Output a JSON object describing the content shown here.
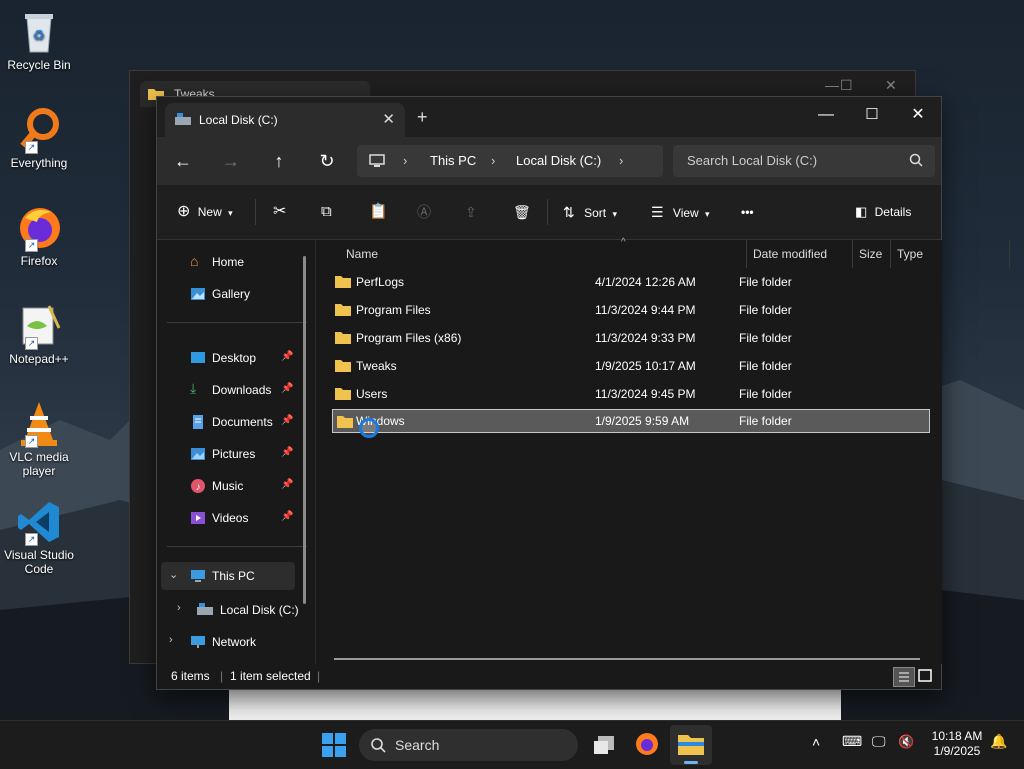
{
  "desktop": {
    "icons": [
      {
        "label": "Recycle Bin"
      },
      {
        "label": "Everything"
      },
      {
        "label": "Firefox"
      },
      {
        "label": "Notepad++"
      },
      {
        "label": "VLC media player"
      },
      {
        "label": "Visual Studio Code"
      }
    ]
  },
  "back_window": {
    "tab_label": "Tweaks"
  },
  "window": {
    "tab_label": "Local Disk (C:)",
    "breadcrumb": [
      "This PC",
      "Local Disk (C:)"
    ],
    "search_placeholder": "Search Local Disk (C:)",
    "toolbar": {
      "new_label": "New",
      "sort_label": "Sort",
      "view_label": "View",
      "more_label": "•••",
      "details_label": "Details"
    },
    "sidebar": {
      "top": [
        {
          "label": "Home"
        },
        {
          "label": "Gallery"
        }
      ],
      "pinned": [
        {
          "label": "Desktop"
        },
        {
          "label": "Downloads"
        },
        {
          "label": "Documents"
        },
        {
          "label": "Pictures"
        },
        {
          "label": "Music"
        },
        {
          "label": "Videos"
        }
      ],
      "tree": [
        {
          "label": "This PC"
        },
        {
          "label": "Local Disk (C:)"
        },
        {
          "label": "Network"
        }
      ]
    },
    "columns": {
      "name": "Name",
      "date": "Date modified",
      "type": "Type",
      "size": "Size"
    },
    "rows": [
      {
        "name": "PerfLogs",
        "date": "4/1/2024 12:26 AM",
        "type": "File folder"
      },
      {
        "name": "Program Files",
        "date": "11/3/2024 9:44 PM",
        "type": "File folder"
      },
      {
        "name": "Program Files (x86)",
        "date": "11/3/2024 9:33 PM",
        "type": "File folder"
      },
      {
        "name": "Tweaks",
        "date": "1/9/2025 10:17 AM",
        "type": "File folder"
      },
      {
        "name": "Users",
        "date": "11/3/2024 9:45 PM",
        "type": "File folder"
      },
      {
        "name": "Windows",
        "date": "1/9/2025 9:59 AM",
        "type": "File folder"
      }
    ],
    "status": {
      "count": "6 items",
      "selected": "1 item selected"
    }
  },
  "taskbar": {
    "search_label": "Search",
    "time": "10:18 AM",
    "date": "1/9/2025"
  },
  "colors": {
    "folder": "#f0c34e",
    "accent": "#1a7ae0"
  }
}
